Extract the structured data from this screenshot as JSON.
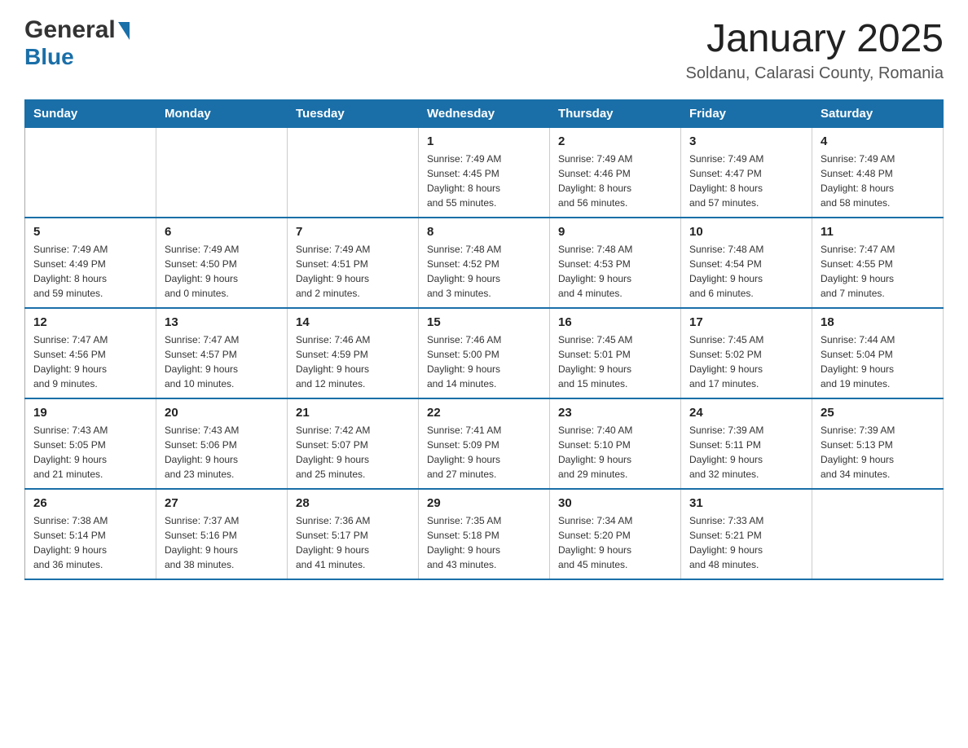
{
  "header": {
    "logo_general": "General",
    "logo_blue": "Blue",
    "title": "January 2025",
    "subtitle": "Soldanu, Calarasi County, Romania"
  },
  "days_of_week": [
    "Sunday",
    "Monday",
    "Tuesday",
    "Wednesday",
    "Thursday",
    "Friday",
    "Saturday"
  ],
  "weeks": [
    [
      {
        "day": "",
        "info": ""
      },
      {
        "day": "",
        "info": ""
      },
      {
        "day": "",
        "info": ""
      },
      {
        "day": "1",
        "info": "Sunrise: 7:49 AM\nSunset: 4:45 PM\nDaylight: 8 hours\nand 55 minutes."
      },
      {
        "day": "2",
        "info": "Sunrise: 7:49 AM\nSunset: 4:46 PM\nDaylight: 8 hours\nand 56 minutes."
      },
      {
        "day": "3",
        "info": "Sunrise: 7:49 AM\nSunset: 4:47 PM\nDaylight: 8 hours\nand 57 minutes."
      },
      {
        "day": "4",
        "info": "Sunrise: 7:49 AM\nSunset: 4:48 PM\nDaylight: 8 hours\nand 58 minutes."
      }
    ],
    [
      {
        "day": "5",
        "info": "Sunrise: 7:49 AM\nSunset: 4:49 PM\nDaylight: 8 hours\nand 59 minutes."
      },
      {
        "day": "6",
        "info": "Sunrise: 7:49 AM\nSunset: 4:50 PM\nDaylight: 9 hours\nand 0 minutes."
      },
      {
        "day": "7",
        "info": "Sunrise: 7:49 AM\nSunset: 4:51 PM\nDaylight: 9 hours\nand 2 minutes."
      },
      {
        "day": "8",
        "info": "Sunrise: 7:48 AM\nSunset: 4:52 PM\nDaylight: 9 hours\nand 3 minutes."
      },
      {
        "day": "9",
        "info": "Sunrise: 7:48 AM\nSunset: 4:53 PM\nDaylight: 9 hours\nand 4 minutes."
      },
      {
        "day": "10",
        "info": "Sunrise: 7:48 AM\nSunset: 4:54 PM\nDaylight: 9 hours\nand 6 minutes."
      },
      {
        "day": "11",
        "info": "Sunrise: 7:47 AM\nSunset: 4:55 PM\nDaylight: 9 hours\nand 7 minutes."
      }
    ],
    [
      {
        "day": "12",
        "info": "Sunrise: 7:47 AM\nSunset: 4:56 PM\nDaylight: 9 hours\nand 9 minutes."
      },
      {
        "day": "13",
        "info": "Sunrise: 7:47 AM\nSunset: 4:57 PM\nDaylight: 9 hours\nand 10 minutes."
      },
      {
        "day": "14",
        "info": "Sunrise: 7:46 AM\nSunset: 4:59 PM\nDaylight: 9 hours\nand 12 minutes."
      },
      {
        "day": "15",
        "info": "Sunrise: 7:46 AM\nSunset: 5:00 PM\nDaylight: 9 hours\nand 14 minutes."
      },
      {
        "day": "16",
        "info": "Sunrise: 7:45 AM\nSunset: 5:01 PM\nDaylight: 9 hours\nand 15 minutes."
      },
      {
        "day": "17",
        "info": "Sunrise: 7:45 AM\nSunset: 5:02 PM\nDaylight: 9 hours\nand 17 minutes."
      },
      {
        "day": "18",
        "info": "Sunrise: 7:44 AM\nSunset: 5:04 PM\nDaylight: 9 hours\nand 19 minutes."
      }
    ],
    [
      {
        "day": "19",
        "info": "Sunrise: 7:43 AM\nSunset: 5:05 PM\nDaylight: 9 hours\nand 21 minutes."
      },
      {
        "day": "20",
        "info": "Sunrise: 7:43 AM\nSunset: 5:06 PM\nDaylight: 9 hours\nand 23 minutes."
      },
      {
        "day": "21",
        "info": "Sunrise: 7:42 AM\nSunset: 5:07 PM\nDaylight: 9 hours\nand 25 minutes."
      },
      {
        "day": "22",
        "info": "Sunrise: 7:41 AM\nSunset: 5:09 PM\nDaylight: 9 hours\nand 27 minutes."
      },
      {
        "day": "23",
        "info": "Sunrise: 7:40 AM\nSunset: 5:10 PM\nDaylight: 9 hours\nand 29 minutes."
      },
      {
        "day": "24",
        "info": "Sunrise: 7:39 AM\nSunset: 5:11 PM\nDaylight: 9 hours\nand 32 minutes."
      },
      {
        "day": "25",
        "info": "Sunrise: 7:39 AM\nSunset: 5:13 PM\nDaylight: 9 hours\nand 34 minutes."
      }
    ],
    [
      {
        "day": "26",
        "info": "Sunrise: 7:38 AM\nSunset: 5:14 PM\nDaylight: 9 hours\nand 36 minutes."
      },
      {
        "day": "27",
        "info": "Sunrise: 7:37 AM\nSunset: 5:16 PM\nDaylight: 9 hours\nand 38 minutes."
      },
      {
        "day": "28",
        "info": "Sunrise: 7:36 AM\nSunset: 5:17 PM\nDaylight: 9 hours\nand 41 minutes."
      },
      {
        "day": "29",
        "info": "Sunrise: 7:35 AM\nSunset: 5:18 PM\nDaylight: 9 hours\nand 43 minutes."
      },
      {
        "day": "30",
        "info": "Sunrise: 7:34 AM\nSunset: 5:20 PM\nDaylight: 9 hours\nand 45 minutes."
      },
      {
        "day": "31",
        "info": "Sunrise: 7:33 AM\nSunset: 5:21 PM\nDaylight: 9 hours\nand 48 minutes."
      },
      {
        "day": "",
        "info": ""
      }
    ]
  ]
}
